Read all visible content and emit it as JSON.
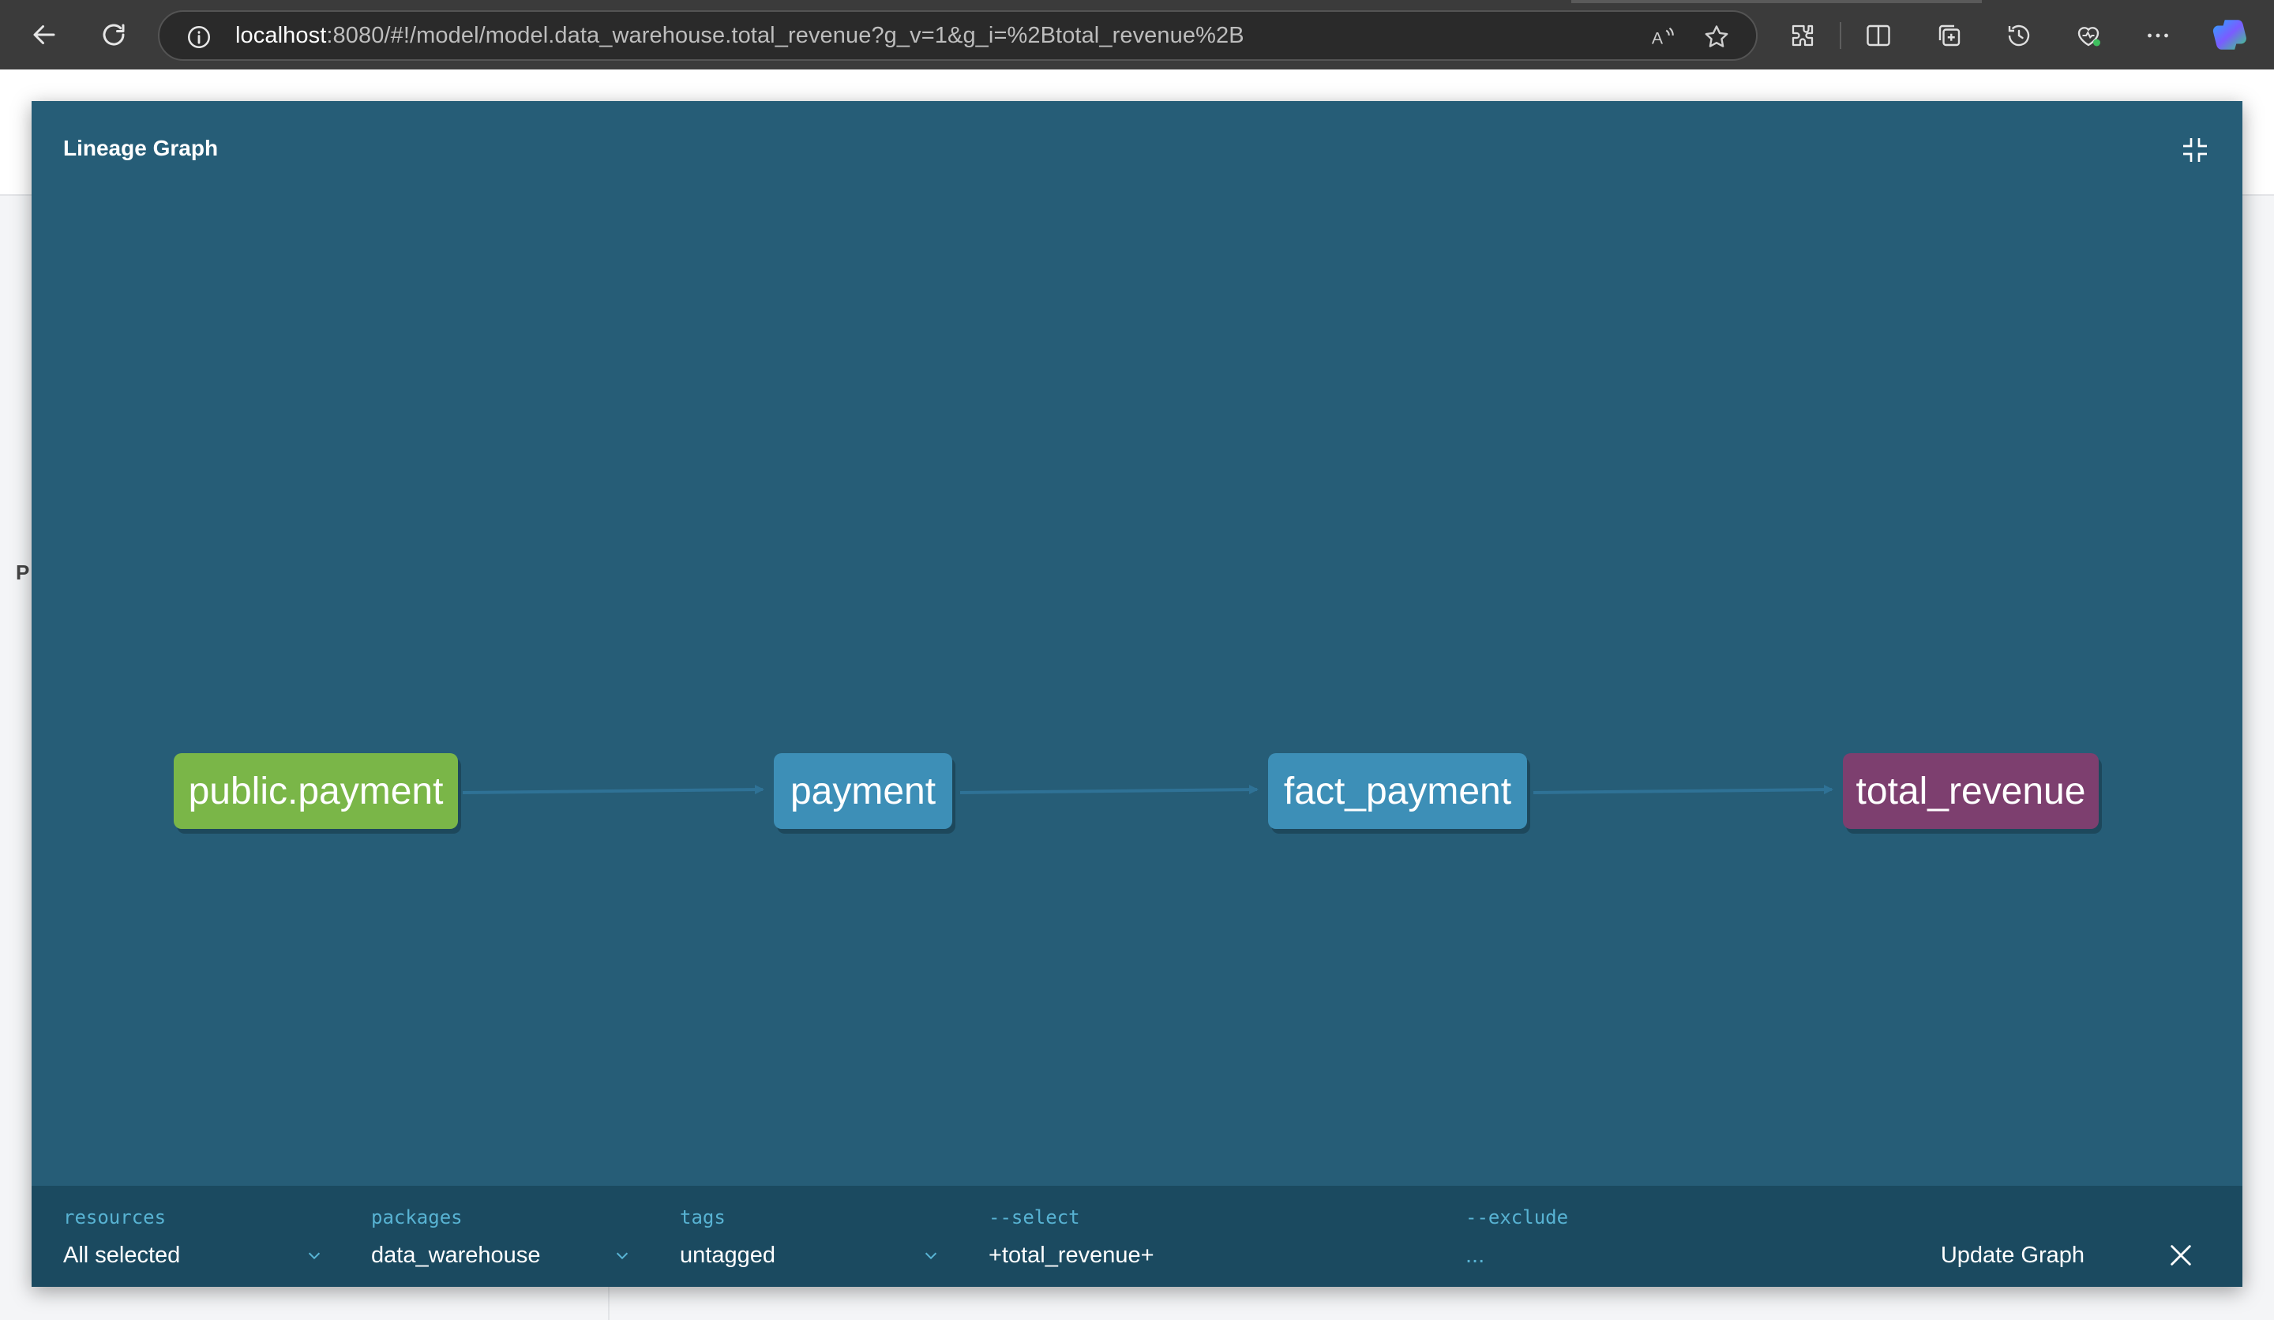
{
  "browser": {
    "url_host": "localhost",
    "url_rest": ":8080/#!/model/model.data_warehouse.total_revenue?g_v=1&g_i=%2Btotal_revenue%2B"
  },
  "backdrop": {
    "partial_letter": "P"
  },
  "modal": {
    "title": "Lineage Graph",
    "background_color": "#265d77"
  },
  "graph": {
    "nodes": [
      {
        "label": "public.payment",
        "kind": "source",
        "color": "#7ab648"
      },
      {
        "label": "payment",
        "kind": "model",
        "color": "#3d8fb7"
      },
      {
        "label": "fact_payment",
        "kind": "model",
        "color": "#3d8fb7"
      },
      {
        "label": "total_revenue",
        "kind": "selected-model",
        "color": "#7d3f6f"
      }
    ],
    "edges": [
      [
        "public.payment",
        "payment"
      ],
      [
        "payment",
        "fact_payment"
      ],
      [
        "fact_payment",
        "total_revenue"
      ]
    ]
  },
  "filters": {
    "resources": {
      "label": "resources",
      "value": "All selected"
    },
    "packages": {
      "label": "packages",
      "value": "data_warehouse"
    },
    "tags": {
      "label": "tags",
      "value": "untagged"
    },
    "select": {
      "label": "--select",
      "value": "+total_revenue+"
    },
    "exclude": {
      "label": "--exclude",
      "value": "..."
    },
    "update_button": "Update Graph"
  }
}
